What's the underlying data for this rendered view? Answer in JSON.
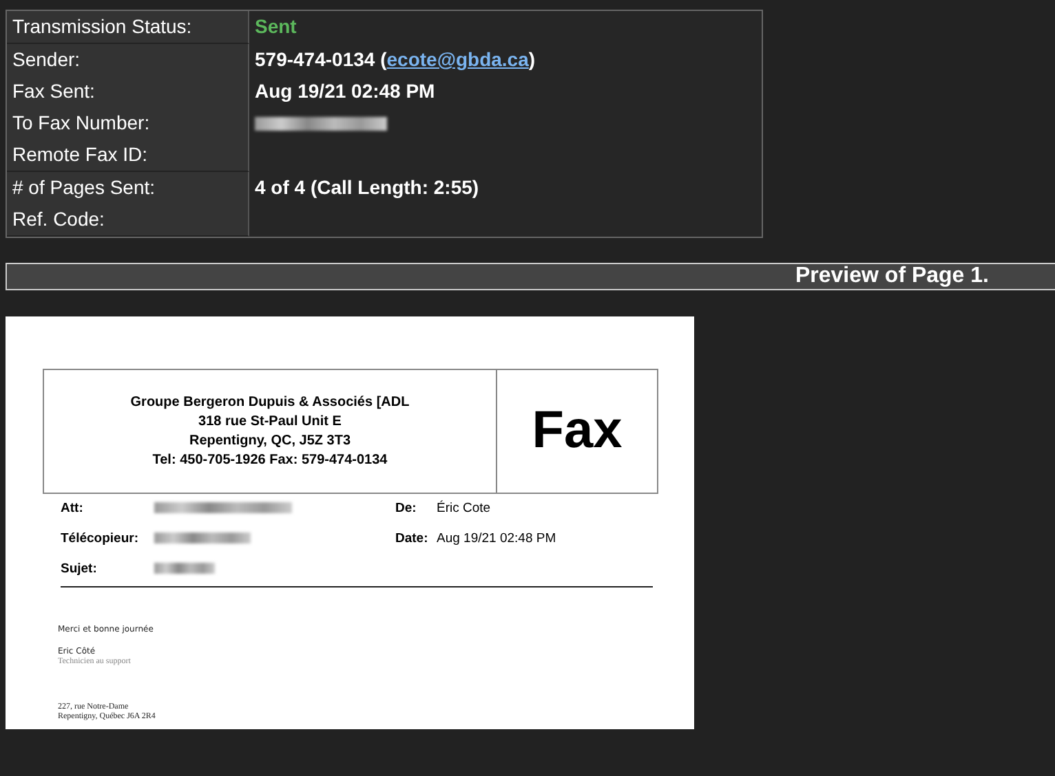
{
  "details": {
    "groups": [
      [
        {
          "label": "Transmission Status:",
          "value": {
            "kind": "status",
            "text": "Sent"
          }
        }
      ],
      [
        {
          "label": "Sender:",
          "value": {
            "kind": "link",
            "before": "579-474-0134 (",
            "link": "ecote@gbda.ca",
            "after": ")"
          }
        },
        {
          "label": "Fax Sent:",
          "value": {
            "kind": "text",
            "text": "Aug 19/21 02:48 PM"
          }
        },
        {
          "label": "To Fax Number:",
          "value": {
            "kind": "redacted"
          }
        },
        {
          "label": "Remote Fax ID:"
        }
      ],
      [
        {
          "label": "# of Pages Sent:",
          "value": {
            "kind": "text",
            "text": "4 of 4 (Call Length: 2:55)"
          }
        },
        {
          "label": "Ref. Code:"
        }
      ]
    ]
  },
  "preview_bar": {
    "title": "Preview of Page 1."
  },
  "fax_page": {
    "letterhead": [
      "Groupe Bergeron Dupuis & Associés [ADL",
      "318 rue St-Paul Unit E",
      "Repentigny, QC, J5Z 3T3",
      "Tel: 450-705-1926 Fax: 579-474-0134"
    ],
    "title": "Fax",
    "fields": [
      {
        "label": "Att:",
        "value": {
          "kind": "redacted"
        }
      },
      {
        "label": "De:",
        "value": {
          "kind": "text",
          "text": "Éric Cote"
        }
      },
      {
        "label": "Télécopieur:",
        "value": {
          "kind": "redacted"
        }
      },
      {
        "label": "Date:",
        "value": {
          "kind": "text",
          "text": "Aug 19/21 02:48 PM"
        }
      },
      {
        "label": "Sujet:",
        "value": {
          "kind": "redacted"
        }
      }
    ],
    "body": [
      "Merci et bonne journée"
    ],
    "signature": {
      "name": "Eric Côté",
      "role": "Technicien au support"
    },
    "address": [
      "227, rue Notre-Dame",
      "Repentigny, Québec J6A 2R4"
    ]
  }
}
